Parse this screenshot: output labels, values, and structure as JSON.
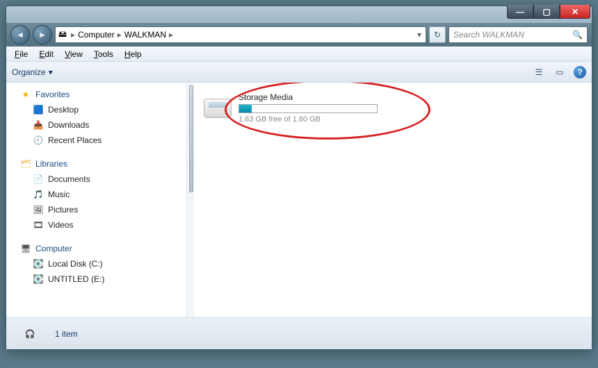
{
  "window_controls": {
    "min": "—",
    "max": "▢",
    "close": "✕"
  },
  "nav": {
    "back": "◄",
    "forward": "►"
  },
  "breadcrumb": {
    "icon": "🖴",
    "seg1": "Computer",
    "seg2": "WALKMAN",
    "chevron": "▸",
    "dropdown": "▾",
    "refresh": "↻"
  },
  "search": {
    "placeholder": "Search WALKMAN",
    "mag": "🔍"
  },
  "menu": {
    "file": "File",
    "file_u": "F",
    "edit": "Edit",
    "edit_u": "E",
    "view": "View",
    "view_u": "V",
    "tools": "Tools",
    "tools_u": "T",
    "help": "Help",
    "help_u": "H"
  },
  "toolbar": {
    "organize": "Organize",
    "organize_caret": "▾",
    "view_icon": "☰",
    "preview_icon": "▭",
    "help": "?"
  },
  "sidebar": {
    "favorites": {
      "label": "Favorites",
      "items": [
        {
          "icon": "🟦",
          "label": "Desktop"
        },
        {
          "icon": "📥",
          "label": "Downloads"
        },
        {
          "icon": "🕘",
          "label": "Recent Places"
        }
      ]
    },
    "libraries": {
      "label": "Libraries",
      "items": [
        {
          "icon": "📄",
          "label": "Documents"
        },
        {
          "icon": "🎵",
          "label": "Music"
        },
        {
          "icon": "🖼",
          "label": "Pictures"
        },
        {
          "icon": "🎞",
          "label": "Videos"
        }
      ]
    },
    "computer": {
      "label": "Computer",
      "items": [
        {
          "icon": "💽",
          "label": "Local Disk (C:)"
        },
        {
          "icon": "💽",
          "label": "UNTITLED (E:)"
        }
      ]
    }
  },
  "content": {
    "drive": {
      "name": "Storage Media",
      "subtext": "1.63 GB free of 1.80 GB",
      "used_fraction_percent": "9"
    }
  },
  "status": {
    "icon": "🎧",
    "text": "1 item"
  }
}
